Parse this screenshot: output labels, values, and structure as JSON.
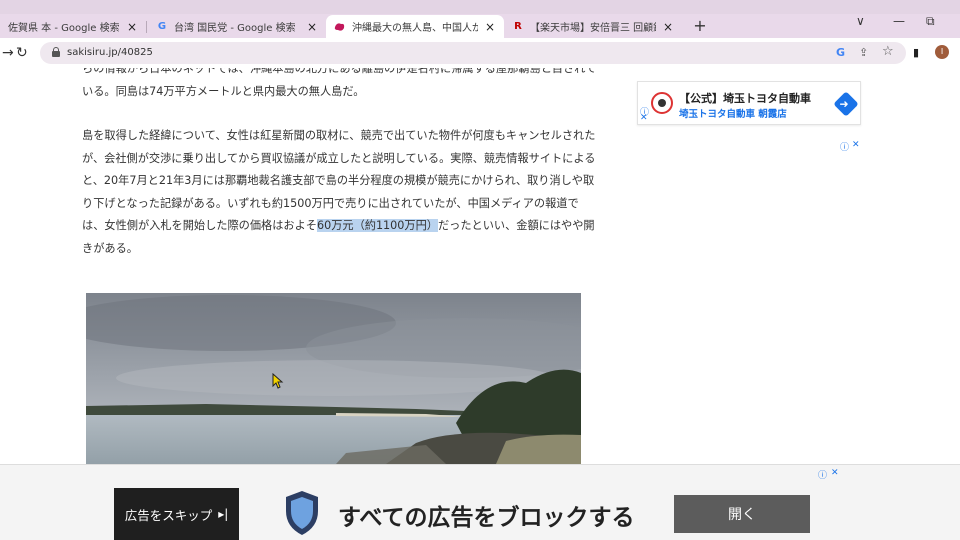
{
  "browser": {
    "tabs": [
      {
        "title": "佐賀県 本 - Google 検索",
        "favicon": "google-icon"
      },
      {
        "title": "台湾 国民党 - Google 検索",
        "favicon": "google-icon"
      },
      {
        "title": "沖縄最大の無人島、中国人が買収",
        "favicon": "site-icon"
      },
      {
        "title": "【楽天市場】安倍晋三 回顧録",
        "favicon": "rakuten-icon"
      }
    ],
    "active_tab": 2,
    "url": "sakisiru.jp/40825",
    "profile_initial": "I",
    "google_glyph": "G",
    "rakuten_glyph": "R",
    "close_glyph": "×",
    "newtab_glyph": "+",
    "nav": {
      "back": "←",
      "forward": "→",
      "reload": "↻"
    },
    "window": {
      "dropdown": "∨",
      "minimize": "—",
      "restore": "⧉"
    },
    "toolbar_icons": {
      "google_lens": "G",
      "share": "⇪",
      "bookmark": "☆",
      "sidebar": "▮",
      "menu": "⋮"
    }
  },
  "article": {
    "p1": "らの情報から日本のネットでは、沖縄本島の北方にある離島の伊是名村に帰属する屋那覇島と目されている。同島は74万平方メートルと県内最大の無人島だ。",
    "p2_main": "島を取得した経緯について、女性は紅星新聞の取材に、競売で出ていた物件が何度もキャンセルされたが、会社側が交渉に乗り出してから買収協議が成立したと説明している。実際、競売情報サイトによると、20年7月と21年3月には那覇地裁名護支部で島の半分程度の規模が競売にかけられ、取り消しや取り下げとなった記録がある。いずれも約1500万円で売りに出されていたが、中国メディアの報道では、女性側が入札を開始した際の価格はおよそ",
    "p2_highlight": "60万元（約1100万円）",
    "p2_end": "だったといい、金額にはやや開きがある。"
  },
  "sidebar_ad": {
    "title": "【公式】埼玉トヨタ自動車",
    "subtitle": "埼玉トヨタ自動車 朝霞店",
    "arrow_glyph": "➜",
    "adchoices_glyph": "ⓘ",
    "close_glyph": "✕"
  },
  "bottom_ad": {
    "skip_label": "広告をスキップ",
    "skip_glyph": "▸|",
    "headline": "すべての広告をブロックする",
    "open_label": "開く",
    "adchoices_glyph": "ⓘ",
    "close_glyph": "✕"
  },
  "colors": {
    "tab_strip": "#e9d9ea",
    "highlight": "#b9d3ef",
    "link_blue": "#1a73e8",
    "skip_bg": "#1f1f1f",
    "open_bg": "#5c5c5c"
  }
}
